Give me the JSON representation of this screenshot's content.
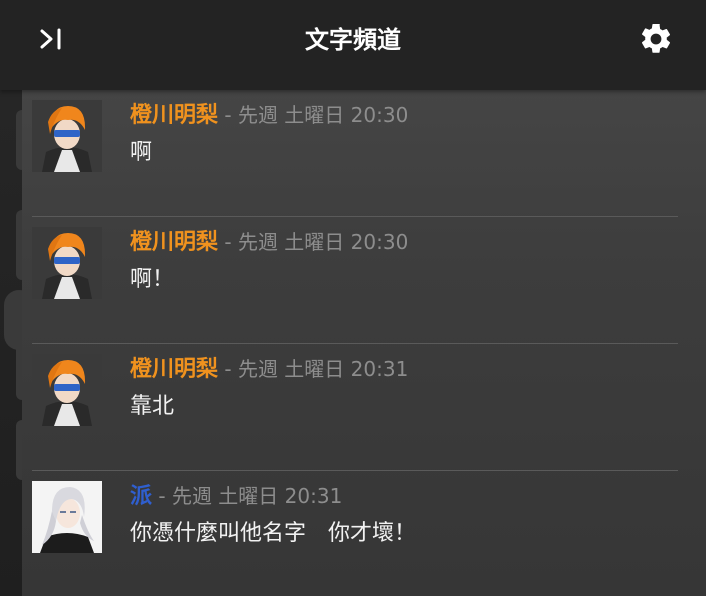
{
  "header": {
    "title": "文字頻道",
    "collapse_icon": "collapse-panel-icon",
    "settings_icon": "gear-icon"
  },
  "colors": {
    "header_bg": "#232323",
    "author_orange": "#f0921e",
    "author_blue": "#2f5fd0",
    "timestamp": "#8d8d8d",
    "message_text": "#f2f2f2"
  },
  "messages": [
    {
      "author": "橙川明梨",
      "separator": " - ",
      "time": "先週 土曜日 20:30",
      "text": "啊",
      "avatar": "orange-hair-avatar",
      "author_color": "#f0921e"
    },
    {
      "author": "橙川明梨",
      "separator": " - ",
      "time": "先週 土曜日 20:30",
      "text": "啊！",
      "avatar": "orange-hair-avatar",
      "author_color": "#f0921e"
    },
    {
      "author": "橙川明梨",
      "separator": " - ",
      "time": "先週 土曜日 20:31",
      "text": "靠北",
      "avatar": "orange-hair-avatar",
      "author_color": "#f0921e"
    },
    {
      "author": "派",
      "separator": " - ",
      "time": "先週 土曜日 20:31",
      "text": "你憑什麼叫他名字　你才壞！",
      "avatar": "white-hair-avatar",
      "author_color": "#2f5fd0"
    }
  ]
}
